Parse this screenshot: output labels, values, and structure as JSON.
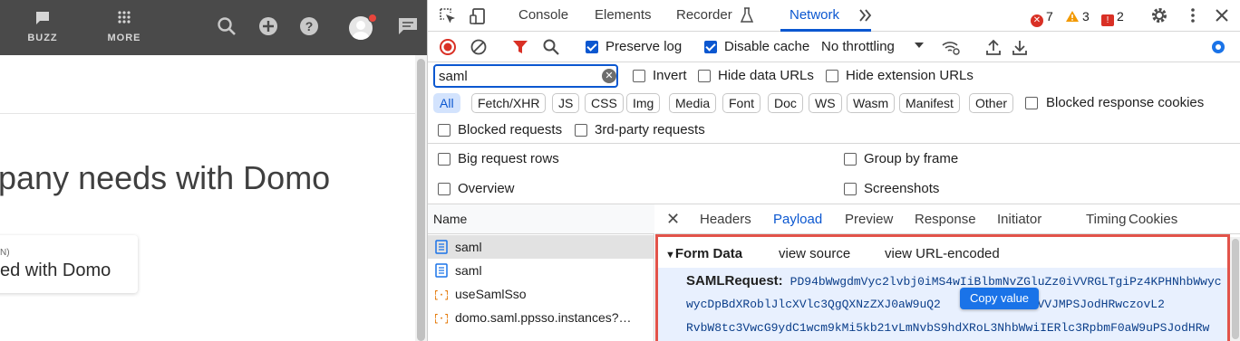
{
  "app": {
    "nav": [
      {
        "label": "BUZZ",
        "icon": "chat-bubble-icon"
      },
      {
        "label": "MORE",
        "icon": "grid-dots-icon"
      }
    ],
    "headline": "pany needs with Domo",
    "cta_small": "N)",
    "cta_text": "ed with Domo"
  },
  "devtools": {
    "tabs": [
      "Console",
      "Elements",
      "Recorder",
      "Network"
    ],
    "active_tab": "Network",
    "counters": {
      "errors": "7",
      "warnings": "3",
      "issues": "2"
    },
    "toolbar": {
      "preserve_log": "Preserve log",
      "disable_cache": "Disable cache",
      "throttling": "No throttling"
    },
    "filter": {
      "value": "saml",
      "invert": "Invert",
      "hide_data_urls": "Hide data URLs",
      "hide_extension_urls": "Hide extension URLs"
    },
    "type_filters": [
      "All",
      "Fetch/XHR",
      "JS",
      "CSS",
      "Img",
      "Media",
      "Font",
      "Doc",
      "WS",
      "Wasm",
      "Manifest",
      "Other"
    ],
    "blocked_response_cookies": "Blocked response cookies",
    "blocked_requests": "Blocked requests",
    "third_party_requests": "3rd-party requests",
    "settings": {
      "big_request_rows": "Big request rows",
      "group_by_frame": "Group by frame",
      "overview": "Overview",
      "screenshots": "Screenshots"
    },
    "list": {
      "header": "Name",
      "requests": [
        {
          "name": "saml",
          "type": "doc"
        },
        {
          "name": "saml",
          "type": "doc"
        },
        {
          "name": "useSamlSso",
          "type": "fetch"
        },
        {
          "name": "domo.saml.ppsso.instances?…",
          "type": "fetch"
        }
      ]
    },
    "detail": {
      "tabs": [
        "Headers",
        "Payload",
        "Preview",
        "Response",
        "Initiator",
        "Timing",
        "Cookies"
      ],
      "active_tab": "Payload",
      "form_data": "Form Data",
      "view_source": "view source",
      "view_url_encoded": "view URL-encoded",
      "saml_key": "SAMLRequest:",
      "saml_line1": "PD94bWwgdmVyc2lvbj0iMS4wIiBlbmNvZGluZz0iVVRGLTgiPz4KPHNhbWwyc",
      "saml_line2a": "wycDpBdXRoblJlcXVlc3QgQXNzZXJ0aW9uQ2",
      "saml_line2b": "KJ2aWNlVVJMPSJodHRwczovL2",
      "saml_line3": "RvbW8tc3VwcG9ydC1wcm9kMi5kb21vLmNvbS9hdXRoL3NhbWwiIERlc3RpbmF0aW9uPSJodHRw",
      "copy_tooltip": "Copy value"
    }
  },
  "colors": {
    "accent": "#0b57d0",
    "error": "#d93025",
    "warning": "#f29900",
    "highlight_border": "#e2534a"
  }
}
